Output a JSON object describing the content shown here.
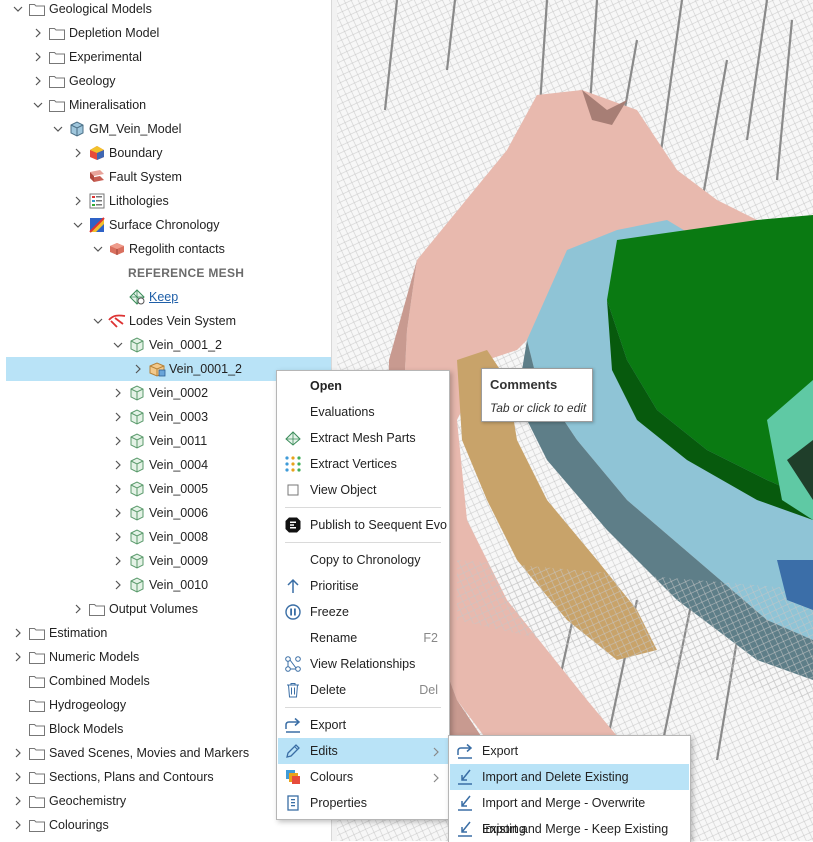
{
  "tree": {
    "items": [
      {
        "label": "Geological Models",
        "icon": "folder-icon",
        "chev": "down"
      },
      {
        "label": "Depletion Model",
        "icon": "folder-icon",
        "chev": "right"
      },
      {
        "label": "Experimental",
        "icon": "folder-icon",
        "chev": "right"
      },
      {
        "label": "Geology",
        "icon": "folder-icon",
        "chev": "right"
      },
      {
        "label": "Mineralisation",
        "icon": "folder-icon",
        "chev": "down"
      },
      {
        "label": "GM_Vein_Model",
        "icon": "geological-model-icon",
        "chev": "down"
      },
      {
        "label": "Boundary",
        "icon": "boundary-icon",
        "chev": "right"
      },
      {
        "label": "Fault System",
        "icon": "fault-system-icon",
        "chev": "none"
      },
      {
        "label": "Lithologies",
        "icon": "lithologies-icon",
        "chev": "right"
      },
      {
        "label": "Surface Chronology",
        "icon": "surface-chronology-icon",
        "chev": "down"
      },
      {
        "label": "Regolith contacts",
        "icon": "contact-surface-icon",
        "chev": "down"
      },
      {
        "label": "REFERENCE MESH",
        "icon": "",
        "chev": "none",
        "style": "bold"
      },
      {
        "label": "Keep",
        "icon": "mesh-icon",
        "chev": "none",
        "style": "link"
      },
      {
        "label": "Lodes Vein System",
        "icon": "vein-system-icon",
        "chev": "down"
      },
      {
        "label": "Vein_0001_2",
        "icon": "vein-icon",
        "chev": "down"
      },
      {
        "label": "Vein_0001_2",
        "icon": "vein-mesh-icon",
        "chev": "right",
        "selected": true
      },
      {
        "label": "Vein_0002",
        "icon": "vein-icon",
        "chev": "right"
      },
      {
        "label": "Vein_0003",
        "icon": "vein-icon",
        "chev": "right"
      },
      {
        "label": "Vein_0011",
        "icon": "vein-icon",
        "chev": "right"
      },
      {
        "label": "Vein_0004",
        "icon": "vein-icon",
        "chev": "right"
      },
      {
        "label": "Vein_0005",
        "icon": "vein-icon",
        "chev": "right"
      },
      {
        "label": "Vein_0006",
        "icon": "vein-icon",
        "chev": "right"
      },
      {
        "label": "Vein_0008",
        "icon": "vein-icon",
        "chev": "right"
      },
      {
        "label": "Vein_0009",
        "icon": "vein-icon",
        "chev": "right"
      },
      {
        "label": "Vein_0010",
        "icon": "vein-icon",
        "chev": "right"
      },
      {
        "label": "Output Volumes",
        "icon": "folder-icon",
        "chev": "right"
      },
      {
        "label": "Estimation",
        "icon": "folder-icon",
        "chev": "right"
      },
      {
        "label": "Numeric Models",
        "icon": "folder-icon",
        "chev": "right"
      },
      {
        "label": "Combined Models",
        "icon": "folder-icon",
        "chev": "none"
      },
      {
        "label": "Hydrogeology",
        "icon": "folder-icon",
        "chev": "none"
      },
      {
        "label": "Block Models",
        "icon": "folder-icon",
        "chev": "none"
      },
      {
        "label": "Saved Scenes, Movies and Markers",
        "icon": "folder-icon",
        "chev": "right"
      },
      {
        "label": "Sections, Plans and Contours",
        "icon": "folder-icon",
        "chev": "right"
      },
      {
        "label": "Geochemistry",
        "icon": "folder-icon",
        "chev": "right"
      },
      {
        "label": "Colourings",
        "icon": "folder-icon",
        "chev": "right"
      }
    ]
  },
  "tooltip": {
    "title": "Comments",
    "body": "Tab or click to edit"
  },
  "context_menu": {
    "items": [
      {
        "label": "Open",
        "icon": "",
        "bold": true
      },
      {
        "label": "Evaluations",
        "icon": ""
      },
      {
        "label": "Extract Mesh Parts",
        "icon": "extract-mesh-parts-icon"
      },
      {
        "label": "Extract Vertices",
        "icon": "extract-vertices-icon"
      },
      {
        "label": "View Object",
        "icon": "checkbox-icon"
      },
      {
        "sep": true
      },
      {
        "label": "Publish to Seequent Evo",
        "icon": "evo-icon"
      },
      {
        "sep": true
      },
      {
        "label": "Copy to Chronology",
        "icon": ""
      },
      {
        "label": "Prioritise",
        "icon": "arrow-up-icon"
      },
      {
        "label": "Freeze",
        "icon": "freeze-icon"
      },
      {
        "label": "Rename",
        "icon": "",
        "shortcut": "F2"
      },
      {
        "label": "View Relationships",
        "icon": "relationships-icon"
      },
      {
        "label": "Delete",
        "icon": "trash-icon",
        "shortcut": "Del"
      },
      {
        "sep": true
      },
      {
        "label": "Export",
        "icon": "export-icon"
      },
      {
        "label": "Edits",
        "icon": "pencil-icon",
        "submenu": true,
        "highlighted": true
      },
      {
        "label": "Colours",
        "icon": "colours-icon",
        "submenu": true
      },
      {
        "label": "Properties",
        "icon": "properties-icon"
      }
    ]
  },
  "submenu": {
    "items": [
      {
        "label": "Export",
        "icon": "export-icon"
      },
      {
        "label": "Import and Delete Existing",
        "icon": "import-icon",
        "highlighted": true
      },
      {
        "label": "Import and Merge - Overwrite Existing",
        "icon": "import-icon"
      },
      {
        "label": "Import and Merge - Keep Existing",
        "icon": "import-icon"
      }
    ]
  },
  "colors": {
    "selection": "#b9e3f7",
    "pink_surface": "#e8b9ae",
    "tan_surface": "#c8a36a",
    "blue_surface": "#8fc4d6",
    "green_surface": "#0a7a12",
    "teal_surface": "#5fc9a4"
  }
}
